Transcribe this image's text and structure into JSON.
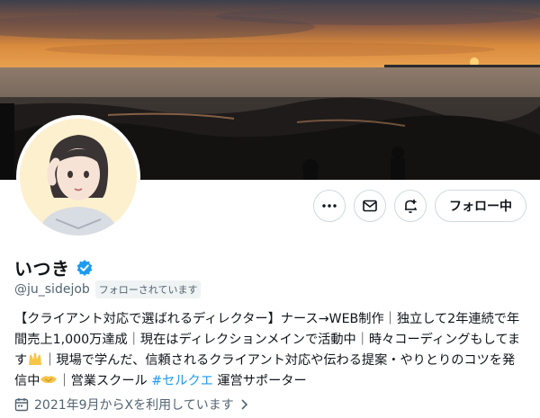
{
  "profile": {
    "name": "いつき",
    "handle": "@ju_sidejob",
    "follows_you": "フォローされています",
    "follow_button": "フォロー中",
    "bio": {
      "part1": "【クライアント対応で選ばれるディレクター】ナース→WEB制作｜独立して2年連続で年間売上1,000万達成｜現在はディレクションメインで活動中｜時々コーディングもしてます",
      "part2": "｜現場で学んだ、信頼されるクライアント対応や伝わる提案・やりとりのコツを発信中",
      "part3": "｜営業スクール ",
      "hashtag": "#セルクエ",
      "part4": " 運営サポーター"
    },
    "joined": "2021年9月からXを利用しています"
  },
  "icons": {
    "more": "more-icon",
    "message": "envelope-icon",
    "notifications": "bell-plus-icon",
    "verified": "verified-badge-icon",
    "calendar": "calendar-icon",
    "chevron": "chevron-right-icon"
  },
  "colors": {
    "accent": "#1d9bf0",
    "secondary_text": "#536471",
    "border": "#cfd9de"
  }
}
